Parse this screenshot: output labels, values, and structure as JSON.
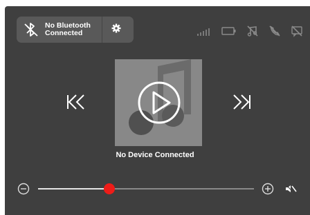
{
  "bluetooth": {
    "status_text": "No Bluetooth Connected",
    "icon": "bluetooth-off-icon"
  },
  "settings": {
    "icon": "gear-icon"
  },
  "status_bar": {
    "icons": [
      "signal-strength-icon",
      "battery-icon",
      "no-music-icon",
      "no-phone-icon",
      "no-message-icon"
    ]
  },
  "player": {
    "device_label": "No Device Connected",
    "album_icon": "music-note-icon",
    "play_icon": "play-icon",
    "prev_icon": "previous-track-icon",
    "next_icon": "next-track-icon"
  },
  "volume": {
    "level": 0.33,
    "minus_icon": "minus-circle-icon",
    "plus_icon": "plus-circle-icon",
    "mute_icon": "speaker-muted-icon"
  },
  "colors": {
    "background": "#3f3f3f",
    "pill": "#595959",
    "accent": "#ee1c18",
    "album": "#888888"
  }
}
